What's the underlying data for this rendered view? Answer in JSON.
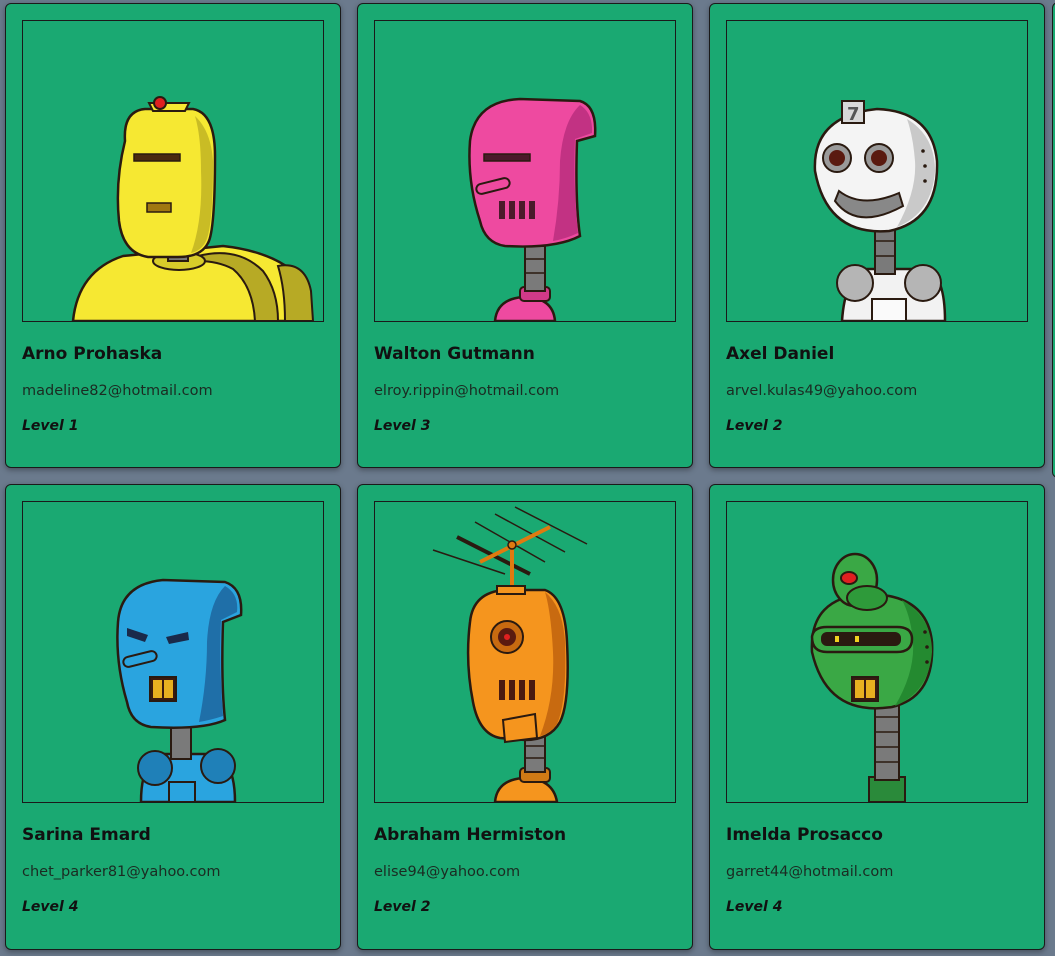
{
  "robots": [
    {
      "name": "Arno Prohaska",
      "email": "madeline82@hotmail.com",
      "level": "Level 1",
      "color": "#f6e832",
      "icon": "yellow-robot-avatar"
    },
    {
      "name": "Walton Gutmann",
      "email": "elroy.rippin@hotmail.com",
      "level": "Level 3",
      "color": "#ee4aa0",
      "icon": "pink-robot-avatar"
    },
    {
      "name": "Axel Daniel",
      "email": "arvel.kulas49@yahoo.com",
      "level": "Level 2",
      "color": "#e8e8e8",
      "icon": "white-robot-avatar"
    },
    {
      "name": "Sarina Emard",
      "email": "chet_parker81@yahoo.com",
      "level": "Level 4",
      "color": "#2aa4df",
      "icon": "blue-robot-avatar"
    },
    {
      "name": "Abraham Hermiston",
      "email": "elise94@yahoo.com",
      "level": "Level 2",
      "color": "#f5951e",
      "icon": "orange-robot-avatar"
    },
    {
      "name": "Imelda Prosacco",
      "email": "garret44@hotmail.com",
      "level": "Level 4",
      "color": "#3aa845",
      "icon": "green-robot-avatar"
    }
  ],
  "colors": {
    "page_background": "#6b7a8d",
    "card_background": "#1aa972"
  }
}
